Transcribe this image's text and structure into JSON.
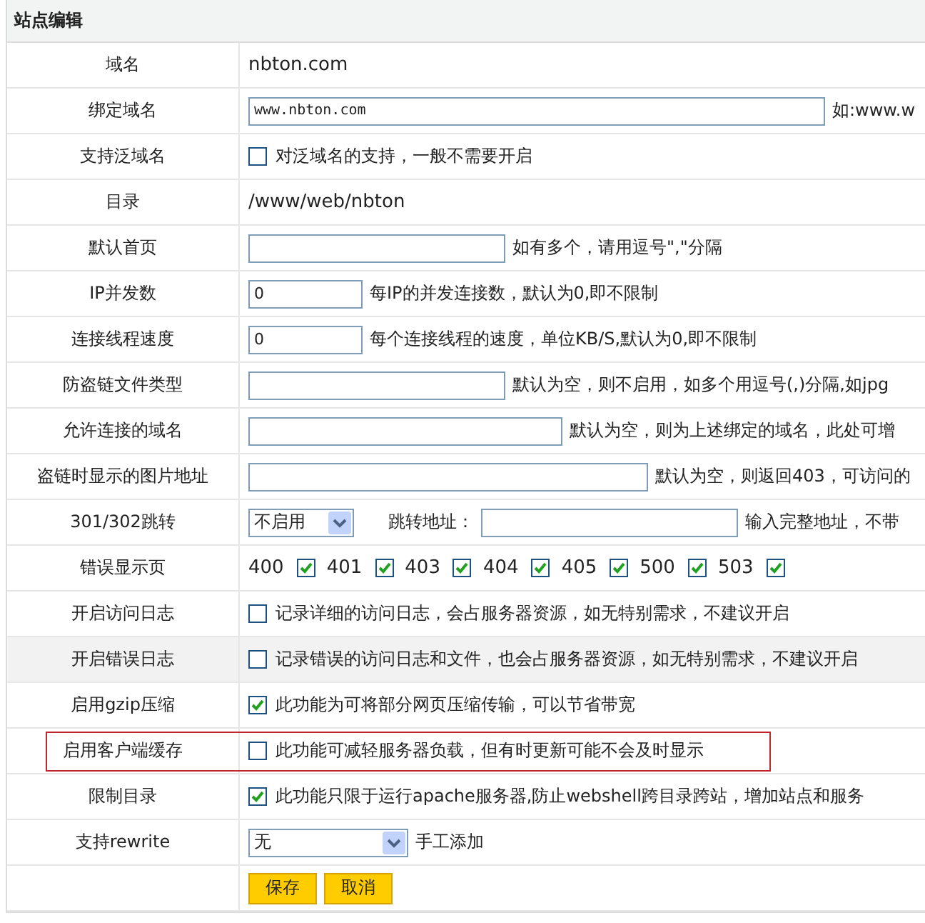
{
  "title": "站点编辑",
  "rows": [
    {
      "kind": "text",
      "label": "域名",
      "value": "nbton.com",
      "highlighted": false,
      "outlined": false
    },
    {
      "kind": "input",
      "label": "绑定域名",
      "value": "www.nbton.com",
      "hint": "如:www.w",
      "highlighted": false,
      "outlined": false
    },
    {
      "kind": "checkbox",
      "label": "支持泛域名",
      "checked": false,
      "text": "对泛域名的支持，一般不需要开启",
      "highlighted": false,
      "outlined": false
    },
    {
      "kind": "text",
      "label": "目录",
      "value": "/www/web/nbton",
      "highlighted": false,
      "outlined": false
    },
    {
      "kind": "input",
      "label": "默认首页",
      "hint": "如有多个，请用逗号\",\"分隔",
      "highlighted": false,
      "outlined": false
    },
    {
      "kind": "input",
      "label": "IP并发数",
      "value": "0",
      "hint": "每IP的并发连接数，默认为0,即不限制",
      "highlighted": false,
      "outlined": false
    },
    {
      "kind": "input",
      "label": "连接线程速度",
      "value": "0",
      "hint": "每个连接线程的速度，单位KB/S,默认为0,即不限制",
      "highlighted": false,
      "outlined": false
    },
    {
      "kind": "input",
      "label": "防盗链文件类型",
      "hint": "默认为空，则不启用，如多个用逗号(,)分隔,如jpg",
      "highlighted": false,
      "outlined": false
    },
    {
      "kind": "input",
      "label": "允许连接的域名",
      "hint": "默认为空，则为上述绑定的域名，此处可增",
      "highlighted": false,
      "outlined": false
    },
    {
      "kind": "input",
      "label": "盗链时显示的图片地址",
      "hint": "默认为空，则返回403，可访问的",
      "highlighted": false,
      "outlined": false
    },
    {
      "kind": "redirect",
      "label": "301/302跳转",
      "select": "不启用",
      "field_label": "跳转地址：",
      "hint": "输入完整地址，不带",
      "highlighted": false,
      "outlined": false
    },
    {
      "kind": "error_pages",
      "label": "错误显示页",
      "pages": [
        {
          "code": "400",
          "checked": true
        },
        {
          "code": "401",
          "checked": true
        },
        {
          "code": "403",
          "checked": true
        },
        {
          "code": "404",
          "checked": true
        },
        {
          "code": "405",
          "checked": true
        },
        {
          "code": "500",
          "checked": true
        },
        {
          "code": "503",
          "checked": true
        }
      ],
      "highlighted": false,
      "outlined": false
    },
    {
      "kind": "checkbox",
      "label": "开启访问日志",
      "checked": false,
      "text": "记录详细的访问日志，会占服务器资源，如无特别需求，不建议开启",
      "highlighted": false,
      "outlined": false
    },
    {
      "kind": "checkbox",
      "label": "开启错误日志",
      "checked": false,
      "text": "记录错误的访问日志和文件，也会占服务器资源，如无特别需求，不建议开启",
      "highlighted": true,
      "outlined": false
    },
    {
      "kind": "checkbox",
      "label": "启用gzip压缩",
      "checked": true,
      "text": "此功能为可将部分网页压缩传输，可以节省带宽",
      "highlighted": false,
      "outlined": false
    },
    {
      "kind": "checkbox",
      "label": "启用客户端缓存",
      "checked": false,
      "text": "此功能可减轻服务器负载，但有时更新可能不会及时显示",
      "highlighted": false,
      "outlined": true
    },
    {
      "kind": "checkbox",
      "label": "限制目录",
      "checked": true,
      "text": "此功能只限于运行apache服务器,防止webshell跨目录跨站，增加站点和服务",
      "highlighted": false,
      "outlined": false
    },
    {
      "kind": "select",
      "label": "支持rewrite",
      "select": "无",
      "hint": "手工添加",
      "highlighted": false,
      "outlined": false
    },
    {
      "kind": "buttons",
      "buttons": [
        "保存",
        "取消"
      ],
      "highlighted": false,
      "outlined": false
    }
  ]
}
